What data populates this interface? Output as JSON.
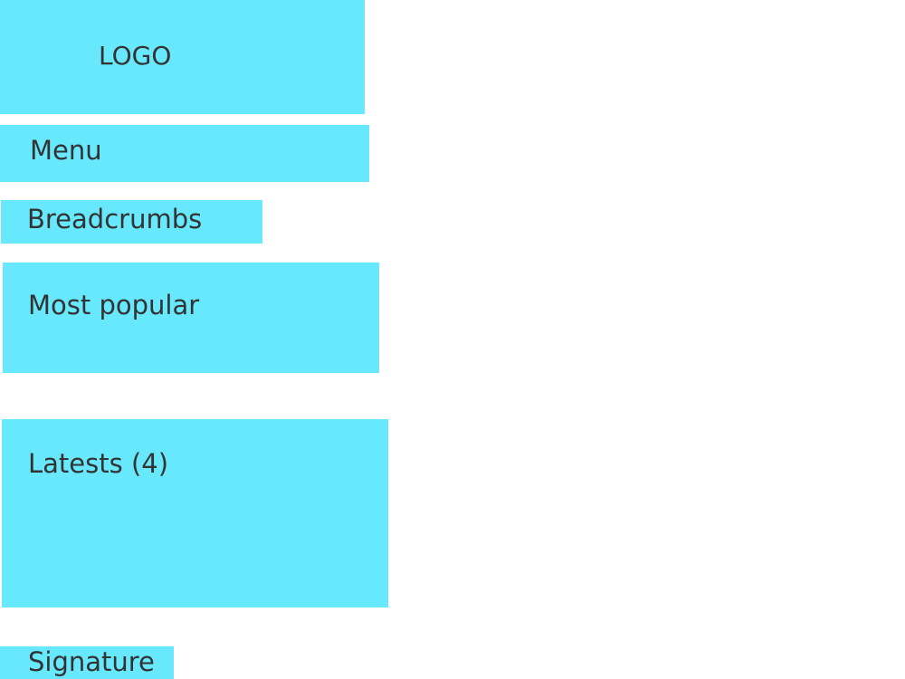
{
  "colors": {
    "block_fill": "#67e8fd",
    "text": "#333333",
    "background": "#ffffff"
  },
  "blocks": {
    "logo": "LOGO",
    "menu": "Menu",
    "breadcrumbs": "Breadcrumbs",
    "most_popular": "Most popular",
    "latests": "Latests (4)",
    "signature": "Signature"
  }
}
